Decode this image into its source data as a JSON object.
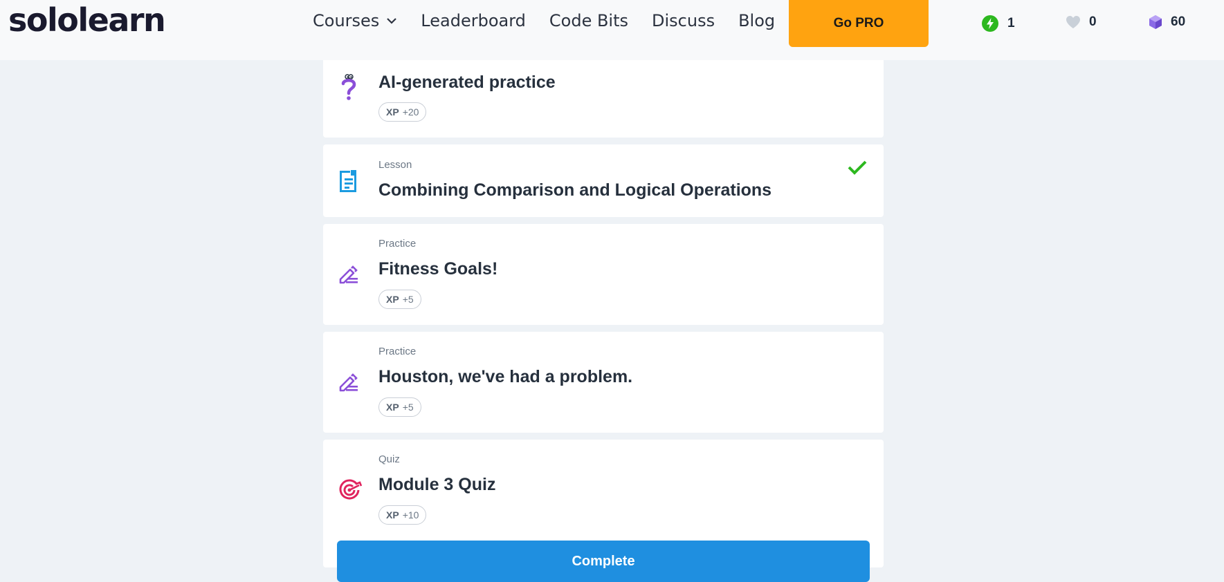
{
  "header": {
    "logo": "sololearn",
    "nav": [
      "Courses",
      "Leaderboard",
      "Code Bits",
      "Discuss",
      "Blog"
    ],
    "go_pro": "Go PRO",
    "stats": {
      "streak": "1",
      "hearts": "0",
      "gems": "60"
    }
  },
  "lessons": [
    {
      "type": "",
      "title": "AI-generated practice",
      "xp_label": "XP",
      "xp_value": "+20",
      "icon": "question-mark-icon"
    },
    {
      "type": "Lesson",
      "title": "Combining Comparison and Logical Operations",
      "completed": true,
      "icon": "document-icon"
    },
    {
      "type": "Practice",
      "title": "Fitness Goals!",
      "xp_label": "XP",
      "xp_value": "+5",
      "icon": "pencil-icon"
    },
    {
      "type": "Practice",
      "title": "Houston, we've had a problem.",
      "xp_label": "XP",
      "xp_value": "+5",
      "icon": "pencil-icon"
    },
    {
      "type": "Quiz",
      "title": "Module 3 Quiz",
      "xp_label": "XP",
      "xp_value": "+10",
      "icon": "target-icon"
    }
  ],
  "complete_button": "Complete",
  "colors": {
    "accent": "#1f8fe0",
    "pro": "#ffa310",
    "check": "#2db81f",
    "practice": "#8b4fd8",
    "quiz": "#e0245e",
    "lesson": "#1b9be0"
  }
}
